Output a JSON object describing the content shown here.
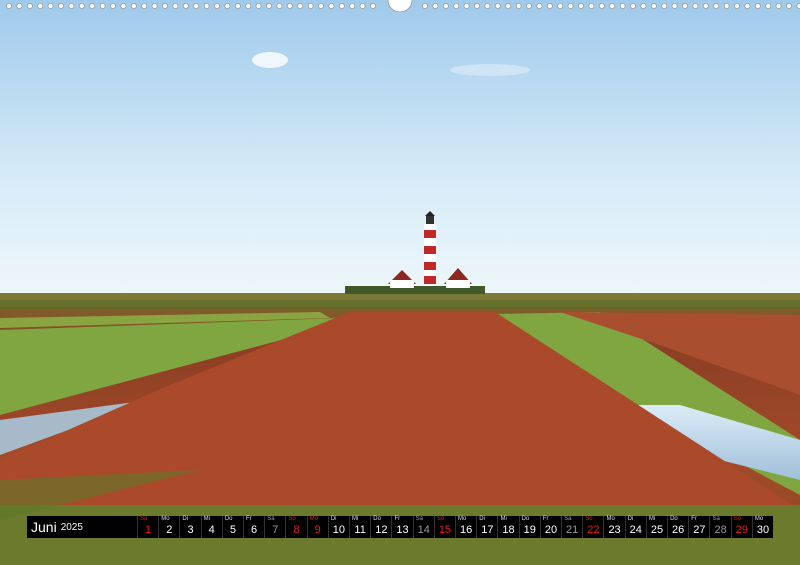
{
  "calendar": {
    "month": "Juni",
    "year": "2025",
    "days": [
      {
        "wd": "So",
        "d": "1",
        "type": "sun"
      },
      {
        "wd": "Mo",
        "d": "2",
        "type": ""
      },
      {
        "wd": "Di",
        "d": "3",
        "type": ""
      },
      {
        "wd": "Mi",
        "d": "4",
        "type": ""
      },
      {
        "wd": "Do",
        "d": "5",
        "type": ""
      },
      {
        "wd": "Fr",
        "d": "6",
        "type": ""
      },
      {
        "wd": "Sa",
        "d": "7",
        "type": "sat"
      },
      {
        "wd": "So",
        "d": "8",
        "type": "sun"
      },
      {
        "wd": "Mo",
        "d": "9",
        "type": "sun"
      },
      {
        "wd": "Di",
        "d": "10",
        "type": ""
      },
      {
        "wd": "Mi",
        "d": "11",
        "type": ""
      },
      {
        "wd": "Do",
        "d": "12",
        "type": ""
      },
      {
        "wd": "Fr",
        "d": "13",
        "type": ""
      },
      {
        "wd": "Sa",
        "d": "14",
        "type": "sat"
      },
      {
        "wd": "So",
        "d": "15",
        "type": "sun"
      },
      {
        "wd": "Mo",
        "d": "16",
        "type": ""
      },
      {
        "wd": "Di",
        "d": "17",
        "type": ""
      },
      {
        "wd": "Mi",
        "d": "18",
        "type": ""
      },
      {
        "wd": "Do",
        "d": "19",
        "type": ""
      },
      {
        "wd": "Fr",
        "d": "20",
        "type": ""
      },
      {
        "wd": "Sa",
        "d": "21",
        "type": "sat"
      },
      {
        "wd": "So",
        "d": "22",
        "type": "sun"
      },
      {
        "wd": "Mo",
        "d": "23",
        "type": ""
      },
      {
        "wd": "Di",
        "d": "24",
        "type": ""
      },
      {
        "wd": "Mi",
        "d": "25",
        "type": ""
      },
      {
        "wd": "Do",
        "d": "26",
        "type": ""
      },
      {
        "wd": "Fr",
        "d": "27",
        "type": ""
      },
      {
        "wd": "Sa",
        "d": "28",
        "type": "sat"
      },
      {
        "wd": "So",
        "d": "29",
        "type": "sun"
      },
      {
        "wd": "Mo",
        "d": "30",
        "type": ""
      }
    ]
  },
  "colors": {
    "sunday": "#e02020",
    "saturday": "#9a9a9a",
    "bar": "#000000"
  }
}
